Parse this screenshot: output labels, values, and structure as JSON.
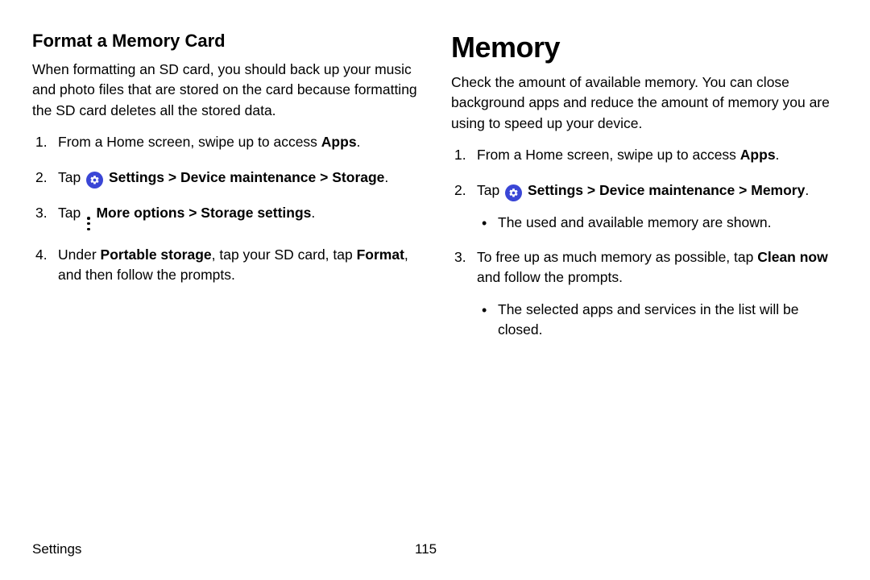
{
  "left": {
    "heading": "Format a Memory Card",
    "intro": "When formatting an SD card, you should back up your music and photo files that are stored on the card because formatting the SD card deletes all the stored data.",
    "step1_a": "From a Home screen, swipe up to access ",
    "step1_b": "Apps",
    "step1_c": ".",
    "step2_tap": "Tap ",
    "step2_settings": "Settings",
    "step2_dm": "Device maintenance",
    "step2_storage": "Storage",
    "step3_tap": "Tap ",
    "step3_more": "More options",
    "step3_ss": "Storage settings",
    "step4_a": "Under ",
    "step4_b": "Portable storage",
    "step4_c": ", tap your SD card, tap ",
    "step4_d": "Format",
    "step4_e": ", and then follow the prompts."
  },
  "right": {
    "heading": "Memory",
    "intro": "Check the amount of available memory. You can close background apps and reduce the amount of memory you are using to speed up your device.",
    "step1_a": "From a Home screen, swipe up to access ",
    "step1_b": "Apps",
    "step1_c": ".",
    "step2_tap": "Tap ",
    "step2_settings": "Settings",
    "step2_dm": "Device maintenance",
    "step2_memory": "Memory",
    "step2_sub": "The used and available memory are shown.",
    "step3_a": "To free up as much memory as possible, tap ",
    "step3_b": "Clean now",
    "step3_c": " and follow the prompts.",
    "step3_sub": "The selected apps and services in the list will be closed."
  },
  "sep": ">",
  "dot": ".",
  "footer": {
    "section": "Settings",
    "page": "115"
  }
}
